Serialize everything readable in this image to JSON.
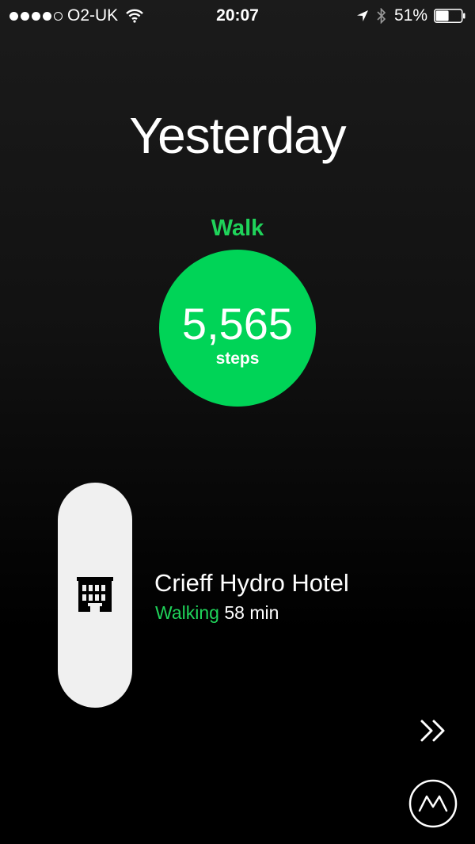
{
  "status_bar": {
    "carrier": "O2-UK",
    "time": "20:07",
    "battery": "51%",
    "signal_bars_filled": 4,
    "signal_bars_total": 5,
    "battery_level": 0.51
  },
  "header": {
    "title": "Yesterday"
  },
  "activity": {
    "label": "Walk",
    "steps": "5,565",
    "unit": "steps",
    "color": "#00d457"
  },
  "place": {
    "name": "Crieff Hydro Hotel",
    "mode": "Walking",
    "duration": "58 min",
    "icon": "hotel-icon"
  },
  "controls": {
    "forward_icon": "double-chevron-right-icon",
    "app_icon": "moves-logo-icon"
  }
}
